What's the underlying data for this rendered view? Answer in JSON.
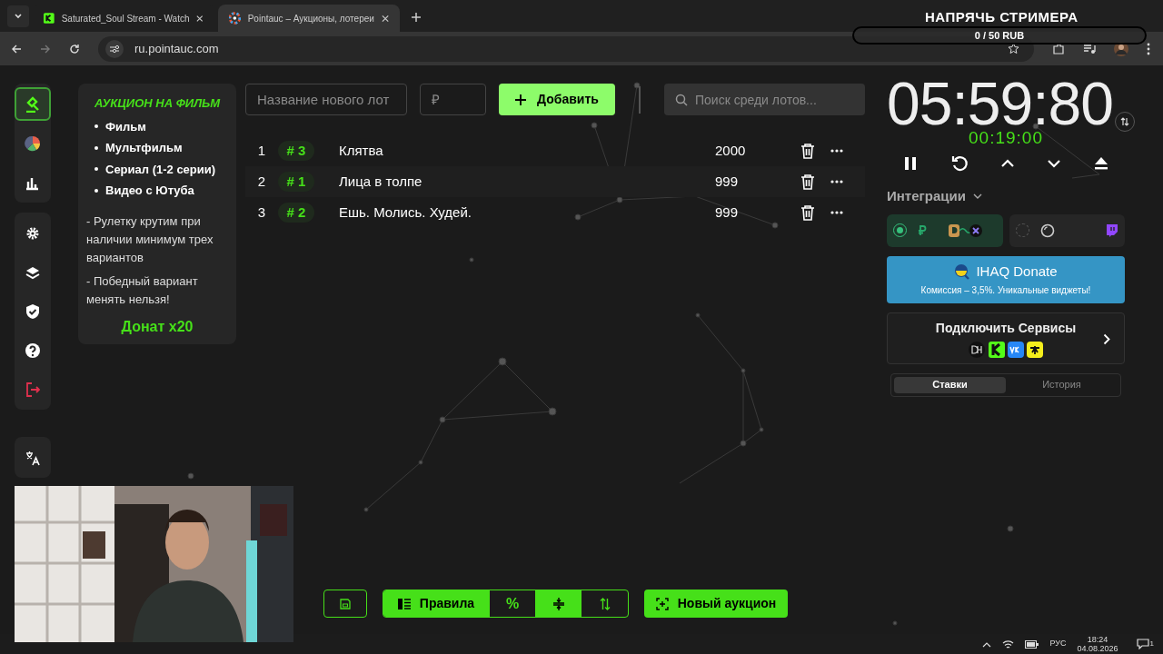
{
  "browser": {
    "tabs": [
      {
        "title": "Saturated_Soul Stream - Watch",
        "selected": false
      },
      {
        "title": "Pointauc – Аукционы, лотереи",
        "selected": true
      }
    ],
    "url": "ru.pointauc.com"
  },
  "stream_overlay": {
    "title": "НАПРЯЧЬ СТРИМЕРА",
    "goal": "0 / 50 RUB",
    "level": 0
  },
  "sidebar": {
    "groups": [
      [
        {
          "kind": "gavel",
          "selected": true
        },
        {
          "kind": "pie",
          "selected": false
        },
        {
          "kind": "bars",
          "selected": false
        }
      ],
      [
        {
          "kind": "gear",
          "selected": false
        },
        {
          "kind": "layers",
          "selected": false
        },
        {
          "kind": "shield",
          "selected": false
        },
        {
          "kind": "help",
          "selected": false
        },
        {
          "kind": "logout",
          "selected": false
        }
      ],
      [
        {
          "kind": "translate",
          "selected": false
        }
      ]
    ]
  },
  "rules": {
    "title": "АУКЦИОН НА ФИЛЬМ",
    "bullets": [
      "Фильм",
      "Мультфильм",
      "Сериал (1-2 серии)",
      "Видео с Ютуба"
    ],
    "notes": [
      "- Рулетку крутим при наличии минимум трех вариантов",
      "- Победный вариант менять нельзя!"
    ],
    "footer": "Донат x20"
  },
  "form": {
    "name_placeholder": "Название нового лот",
    "price_placeholder": "₽",
    "add_button": "Добавить",
    "search_placeholder": "Поиск среди лотов..."
  },
  "lots": [
    {
      "index": "1",
      "rank": "# 3",
      "name": "Клятва",
      "amount": "2000"
    },
    {
      "index": "2",
      "rank": "# 1",
      "name": "Лица в толпе",
      "amount": "999"
    },
    {
      "index": "3",
      "rank": "# 2",
      "name": "Ешь. Молись. Худей.",
      "amount": "999"
    }
  ],
  "timer": {
    "main": "05:59:80",
    "extra": "00:19:00"
  },
  "integrations": {
    "label": "Интеграции",
    "groups": [
      {
        "selected": true
      },
      {
        "selected": false
      }
    ]
  },
  "promo": {
    "title": "IHAQ Donate",
    "subtitle": "Комиссия – 3,5%. Уникальные виджеты!"
  },
  "connect": {
    "title": "Подключить Сервисы"
  },
  "history_tabs": [
    {
      "label": "Ставки",
      "selected": true
    },
    {
      "label": "История",
      "selected": false
    }
  ],
  "toolbar": {
    "rules_button": "Правила",
    "percent_button": "%",
    "new_auction_button": "Новый аукцион"
  },
  "tray": {
    "language": "РУС",
    "time": "18:24",
    "date": "04.08.2026",
    "notifications": "1"
  }
}
